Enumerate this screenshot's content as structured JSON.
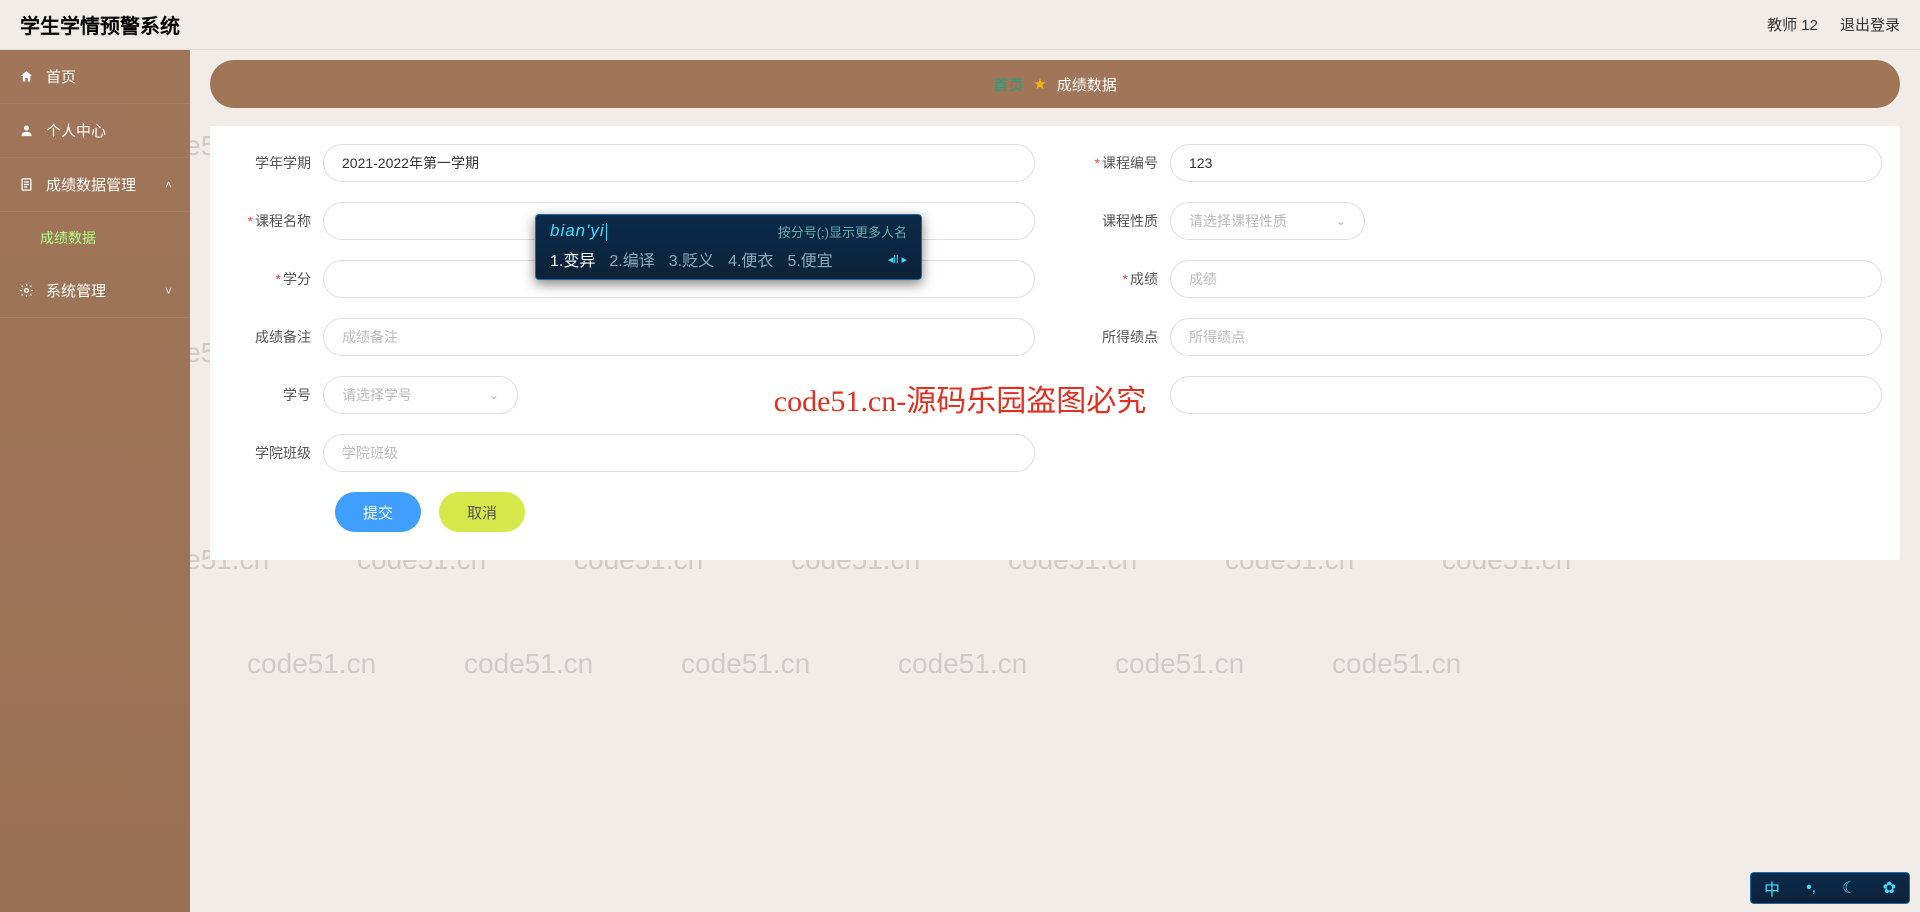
{
  "app": {
    "title": "学生学情预警系统"
  },
  "header": {
    "user": "教师 12",
    "logout": "退出登录"
  },
  "sidebar": {
    "items": [
      {
        "label": "首页"
      },
      {
        "label": "个人中心"
      },
      {
        "label": "成绩数据管理"
      },
      {
        "label": "成绩数据"
      },
      {
        "label": "系统管理"
      }
    ]
  },
  "breadcrumb": {
    "home": "首页",
    "current": "成绩数据"
  },
  "form": {
    "semester": {
      "label": "学年学期",
      "value": "2021-2022年第一学期"
    },
    "courseNo": {
      "label": "课程编号",
      "value": "123"
    },
    "courseName": {
      "label": "课程名称",
      "value": ""
    },
    "courseType": {
      "label": "课程性质",
      "placeholder": "请选择课程性质"
    },
    "credit": {
      "label": "学分"
    },
    "score": {
      "label": "成绩",
      "placeholder": "成绩"
    },
    "scoreNote": {
      "label": "成绩备注",
      "placeholder": "成绩备注"
    },
    "gpa": {
      "label": "所得绩点",
      "placeholder": "所得绩点"
    },
    "studentNo": {
      "label": "学号",
      "placeholder": "请选择学号"
    },
    "college": {
      "label": "学院班级",
      "placeholder": "学院班级"
    },
    "submit": "提交",
    "cancel": "取消"
  },
  "ime": {
    "input": "bian'yi",
    "hint": "按分号(;)显示更多人名",
    "candidates": [
      "1.变异",
      "2.编译",
      "3.贬义",
      "4.便衣",
      "5.便宜"
    ]
  },
  "watermark": {
    "text": "code51.cn",
    "center": "code51.cn-源码乐园盗图必究"
  }
}
